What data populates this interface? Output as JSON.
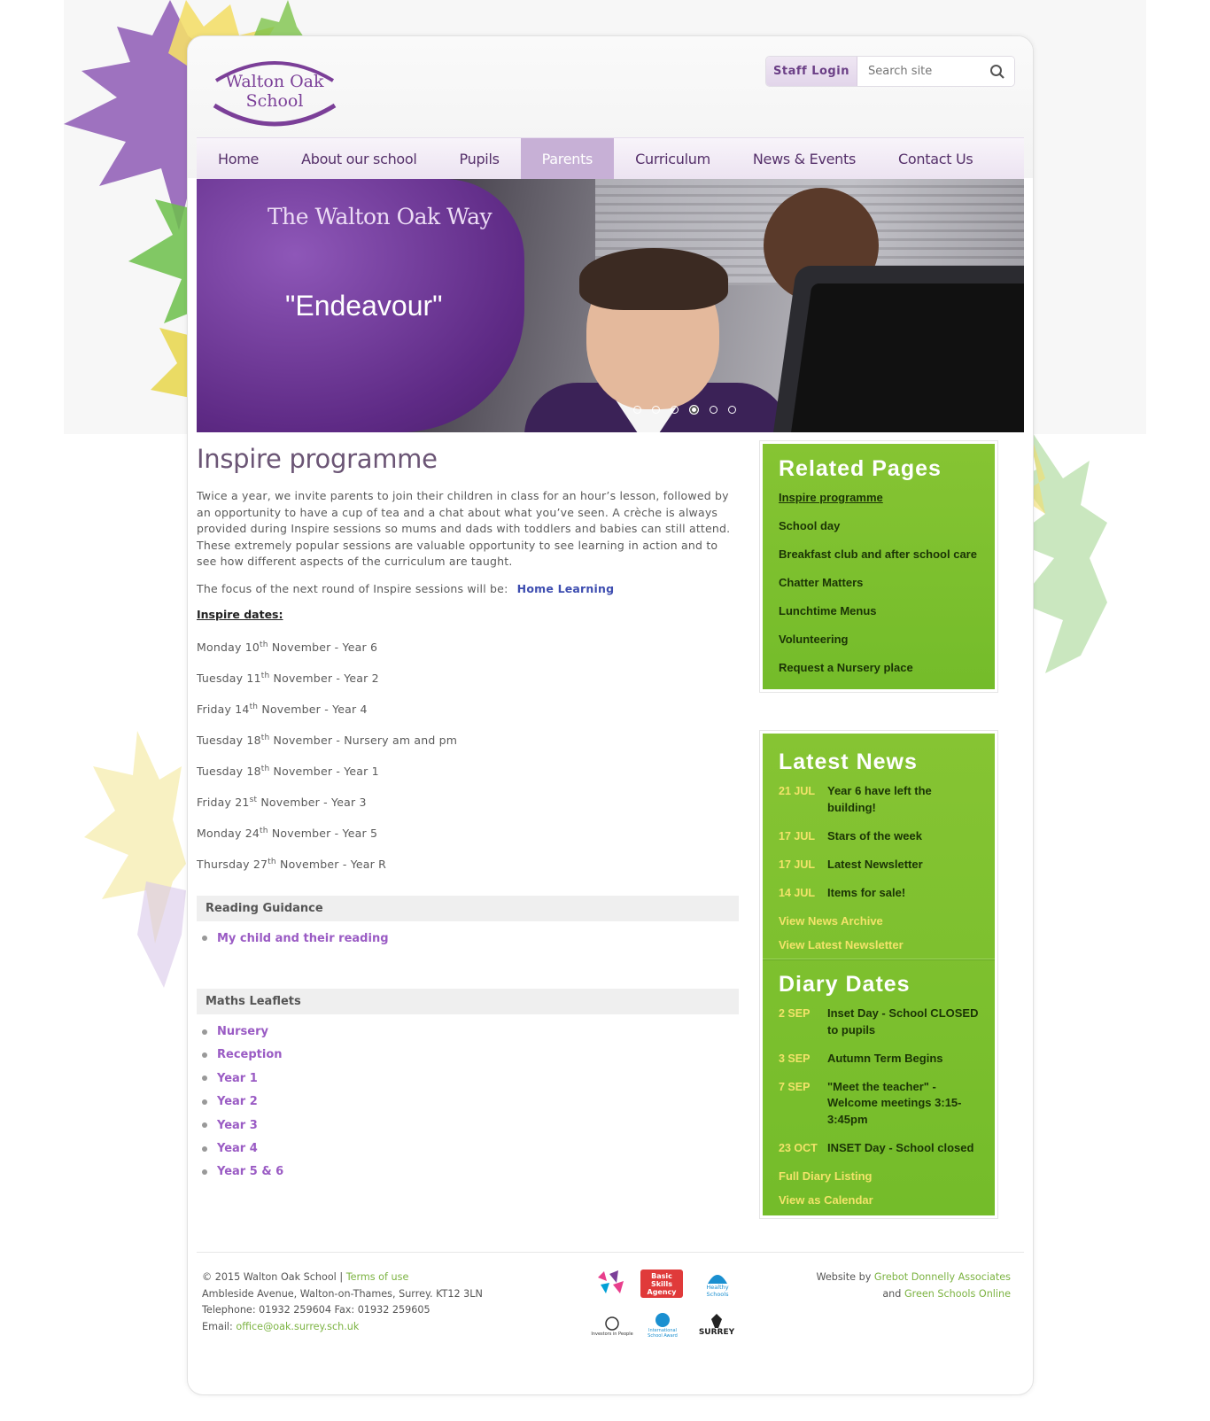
{
  "header": {
    "logo_line1": "Walton Oak",
    "logo_line2": "School",
    "staff_login": "Staff Login",
    "search_placeholder": "Search site"
  },
  "nav": {
    "items": [
      {
        "label": "Home"
      },
      {
        "label": "About our school"
      },
      {
        "label": "Pupils"
      },
      {
        "label": "Parents",
        "active": true
      },
      {
        "label": "Curriculum"
      },
      {
        "label": "News & Events"
      },
      {
        "label": "Contact Us"
      }
    ]
  },
  "hero": {
    "title": "The Walton Oak Way",
    "quote": "\"Endeavour\"",
    "slide_count": 6,
    "active_slide": 4
  },
  "main": {
    "title": "Inspire programme",
    "intro": "Twice a year, we invite parents to join their children in class for an hour’s lesson, followed by an opportunity to have a cup of tea and a chat about what you’ve seen. A crèche is always provided during Inspire sessions so mums and dads with toddlers and babies can still attend. These extremely popular sessions are valuable opportunity to see learning in action and to see how different aspects of the curriculum are taught.",
    "focus_text": "The focus of the next round of Inspire sessions will be:",
    "focus_link": "Home Learning",
    "dates_heading": "Inspire dates:",
    "dates": [
      {
        "day": "Monday 10",
        "suffix": "th",
        "rest": " November - Year 6"
      },
      {
        "day": "Tuesday 11",
        "suffix": "th",
        "rest": " November - Year 2"
      },
      {
        "day": "Friday 14",
        "suffix": "th",
        "rest": " November - Year 4"
      },
      {
        "day": "Tuesday 18",
        "suffix": "th",
        "rest": " November - Nursery am and pm"
      },
      {
        "day": "Tuesday 18",
        "suffix": "th",
        "rest": " November - Year 1"
      },
      {
        "day": "Friday 21",
        "suffix": "st",
        "rest": " November - Year 3"
      },
      {
        "day": "Monday 24",
        "suffix": "th",
        "rest": " November - Year 5"
      },
      {
        "day": "Thursday 27",
        "suffix": "th",
        "rest": " November - Year R"
      }
    ],
    "reading": {
      "heading": "Reading Guidance",
      "links": [
        "My child and their reading"
      ]
    },
    "maths": {
      "heading": "Maths Leaflets",
      "links": [
        "Nursery",
        "Reception",
        "Year 1",
        "Year 2",
        "Year 3",
        "Year 4",
        "Year 5 & 6"
      ]
    }
  },
  "sidebar": {
    "related": {
      "title": "Related Pages",
      "items": [
        "Inspire programme",
        "School day",
        "Breakfast club and after school care",
        "Chatter Matters",
        "Lunchtime Menus",
        "Volunteering",
        "Request a Nursery place"
      ]
    },
    "news": {
      "title": "Latest News",
      "items": [
        {
          "date": "21 JUL",
          "title": "Year 6 have left the building!"
        },
        {
          "date": "17 JUL",
          "title": "Stars of the week"
        },
        {
          "date": "17 JUL",
          "title": "Latest Newsletter"
        },
        {
          "date": "14 JUL",
          "title": "Items for sale!"
        }
      ],
      "archive_link": "View News Archive",
      "newsletter_link": "View Latest Newsletter"
    },
    "diary": {
      "title": "Diary Dates",
      "items": [
        {
          "date": "2 SEP",
          "title": "Inset Day - School CLOSED to pupils"
        },
        {
          "date": "3 SEP",
          "title": "Autumn Term Begins"
        },
        {
          "date": "7 SEP",
          "title": "\"Meet the teacher\" - Welcome meetings 3:15-3:45pm"
        },
        {
          "date": "23 OCT",
          "title": "INSET Day - School closed"
        }
      ],
      "full_link": "Full Diary Listing",
      "calendar_link": "View as Calendar"
    }
  },
  "footer": {
    "copyright": "© 2015 Walton Oak School |",
    "terms": "Terms of use",
    "address": "Ambleside Avenue, Walton-on-Thames, Surrey. KT12 3LN",
    "phone": "Telephone: 01932 259604 Fax: 01932 259605",
    "email_label": "Email:",
    "email": "office@oak.surrey.sch.uk",
    "website_by": "Website by",
    "agency": "Grebot Donnelly Associates",
    "and": "and",
    "partner": "Green Schools Online",
    "logos": [
      "Basic Skills Agency",
      "Healthy Schools",
      "Investors in People",
      "International School Award",
      "SURREY"
    ]
  },
  "colors": {
    "purple": "#7b3f98",
    "green": "#7cbf2f",
    "yellow": "#f2e36a"
  }
}
